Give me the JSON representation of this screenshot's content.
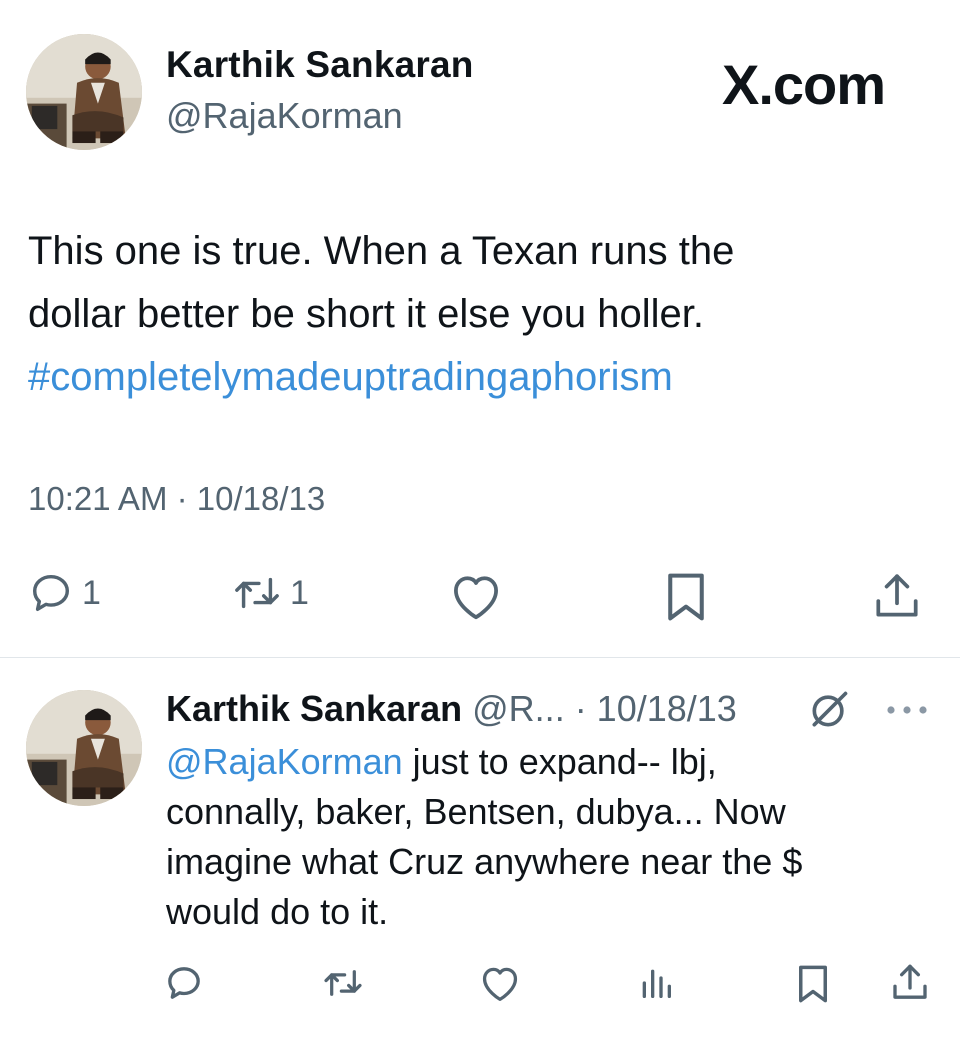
{
  "brand": {
    "label": "X.com"
  },
  "main_tweet": {
    "author_name": "Karthik Sankaran",
    "author_handle": "@RajaKorman",
    "text_lines": [
      "This one is true. When a Texan runs the",
      "dollar better be short it else you holler."
    ],
    "hashtag": "#completelymadeuptradingaphorism",
    "timestamp": "10:21 AM · 10/18/13",
    "actions": {
      "reply_count": "1",
      "repost_count": "1"
    }
  },
  "reply": {
    "author_name": "Karthik Sankaran",
    "meta": "@R... · 10/18/13",
    "mention": "@RajaKorman",
    "line1_rest": " just to expand-- lbj,",
    "lines": [
      "connally, baker, Bentsen, dubya... Now",
      "imagine what Cruz anywhere near the $",
      "would do to it."
    ]
  },
  "icons": {
    "reply": "reply-icon",
    "repost": "repost-icon",
    "like": "heart-icon",
    "bookmark": "bookmark-icon",
    "share": "share-icon",
    "views": "views-icon",
    "grok": "grok-icon",
    "more": "more-icon"
  },
  "colors": {
    "text": "#0f1419",
    "secondary": "#536471",
    "link": "#3b8fd9",
    "divider": "#e1e6ea"
  }
}
